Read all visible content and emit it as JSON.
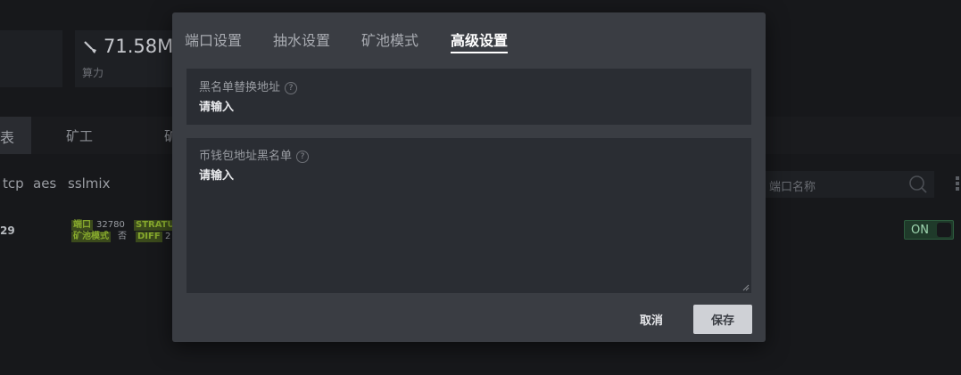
{
  "background": {
    "hashrate_value": "71.58M",
    "hashrate_label": "算力",
    "active_tab": "表",
    "tab_miner": "矿工",
    "tab_third": "矿",
    "protocols": [
      "tcp",
      "aes",
      "sslmix"
    ],
    "search_placeholder": "端口名称",
    "row": {
      "number": "29",
      "tags": {
        "port_tag": "端口",
        "port_value": "32780",
        "stratum_tag": "STRATU",
        "pool_mode_tag": "矿池模式",
        "pool_mode_value": "否",
        "diff_tag": "DIFF",
        "diff_value": "2"
      },
      "toggle": "ON"
    }
  },
  "modal": {
    "tabs": [
      "端口设置",
      "抽水设置",
      "矿池模式",
      "高级设置"
    ],
    "active_tab_index": 3,
    "field1": {
      "label": "黑名单替换地址",
      "help": "?",
      "placeholder": "请输入"
    },
    "field2": {
      "label": "币钱包地址黑名单",
      "help": "?",
      "placeholder": "请输入"
    },
    "cancel_label": "取消",
    "save_label": "保存"
  },
  "colors": {
    "modal_bg": "#3a3d43",
    "field_bg": "#2a2d33",
    "page_bg": "#17181b",
    "tag_green": "#86a82d",
    "toggle_green": "#1f3a2a"
  }
}
